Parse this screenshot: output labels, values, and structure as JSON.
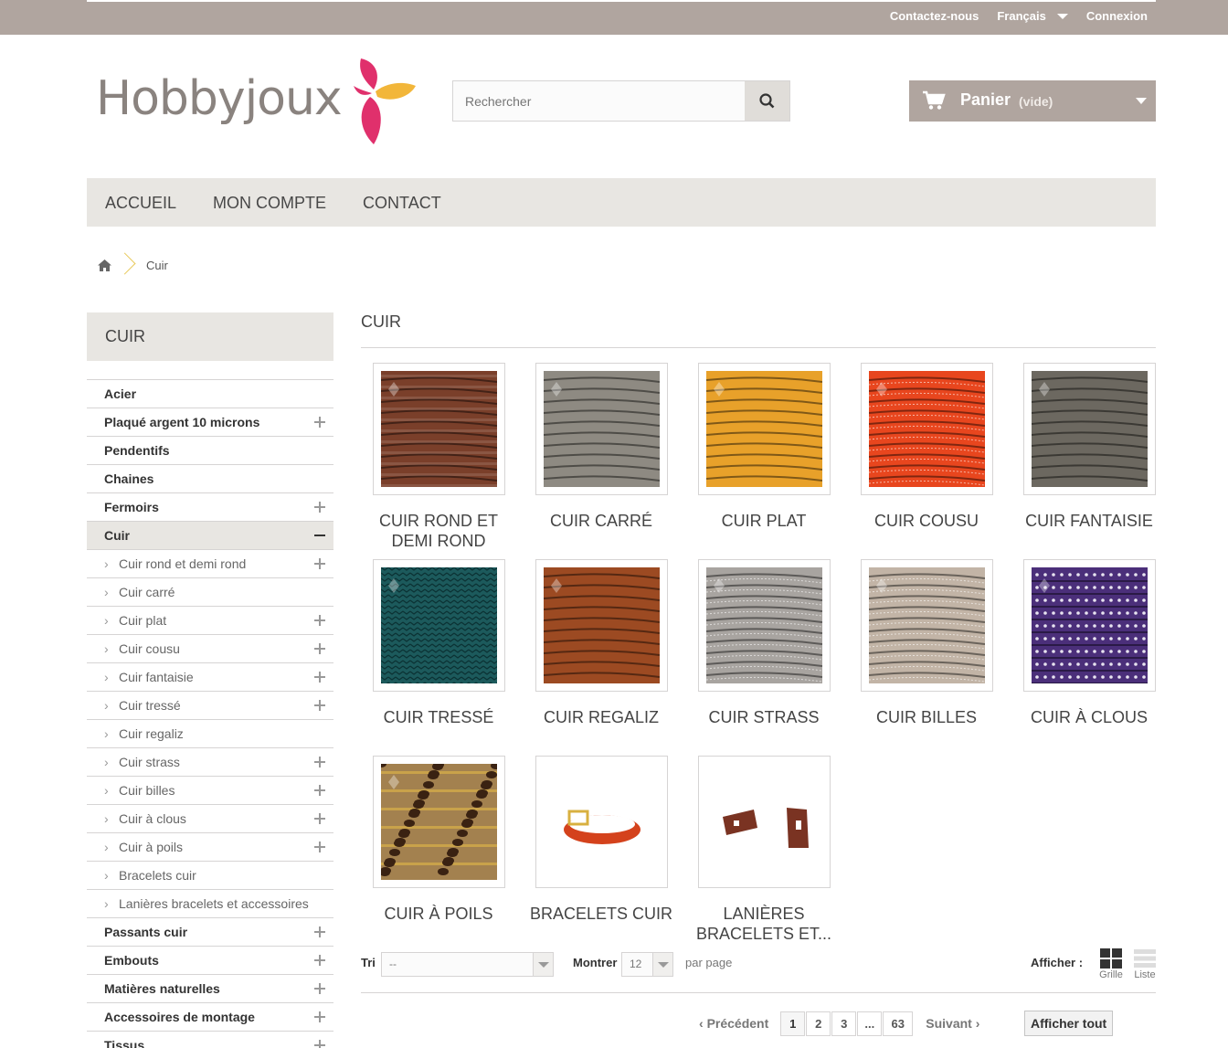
{
  "topbar": {
    "contact": "Contactez-nous",
    "language": "Français",
    "login": "Connexion"
  },
  "logo": {
    "text": "Hobbyjoux"
  },
  "search": {
    "placeholder": "Rechercher"
  },
  "cart": {
    "label": "Panier",
    "status": "(vide)"
  },
  "nav": {
    "items": [
      "ACCUEIL",
      "MON COMPTE",
      "CONTACT"
    ]
  },
  "breadcrumb": {
    "current": "Cuir"
  },
  "sidebar": {
    "title": "CUIR",
    "items": [
      {
        "label": "Acier",
        "toggle": ""
      },
      {
        "label": "Plaqué argent 10 microns",
        "toggle": "plus"
      },
      {
        "label": "Pendentifs",
        "toggle": ""
      },
      {
        "label": "Chaines",
        "toggle": ""
      },
      {
        "label": "Fermoirs",
        "toggle": "plus"
      },
      {
        "label": "Cuir",
        "toggle": "minus",
        "active": true
      },
      {
        "label": "Cuir rond et demi rond",
        "toggle": "plus",
        "sub": true
      },
      {
        "label": "Cuir carré",
        "toggle": "",
        "sub": true
      },
      {
        "label": "Cuir plat",
        "toggle": "plus",
        "sub": true
      },
      {
        "label": "Cuir cousu",
        "toggle": "plus",
        "sub": true
      },
      {
        "label": "Cuir fantaisie",
        "toggle": "plus",
        "sub": true
      },
      {
        "label": "Cuir tressé",
        "toggle": "plus",
        "sub": true
      },
      {
        "label": "Cuir regaliz",
        "toggle": "",
        "sub": true
      },
      {
        "label": "Cuir strass",
        "toggle": "plus",
        "sub": true
      },
      {
        "label": "Cuir billes",
        "toggle": "plus",
        "sub": true
      },
      {
        "label": "Cuir à clous",
        "toggle": "plus",
        "sub": true
      },
      {
        "label": "Cuir à poils",
        "toggle": "plus",
        "sub": true
      },
      {
        "label": "Bracelets cuir",
        "toggle": "",
        "sub": true
      },
      {
        "label": "Lanières bracelets et accessoires",
        "toggle": "",
        "sub": true
      },
      {
        "label": "Passants cuir",
        "toggle": "plus"
      },
      {
        "label": "Embouts",
        "toggle": "plus"
      },
      {
        "label": "Matières naturelles",
        "toggle": "plus"
      },
      {
        "label": "Accessoires de montage",
        "toggle": "plus"
      },
      {
        "label": "Tissus",
        "toggle": "plus"
      }
    ]
  },
  "content": {
    "title": "CUIR",
    "categories": [
      {
        "name": "CUIR ROND ET DEMI ROND",
        "color": "#7a3f2a",
        "style": "stripes"
      },
      {
        "name": "CUIR CARRÉ",
        "color": "#8e8a82",
        "style": "flat"
      },
      {
        "name": "CUIR PLAT",
        "color": "#e8a12a",
        "style": "flat"
      },
      {
        "name": "CUIR COUSU",
        "color": "#e8461e",
        "style": "stitched"
      },
      {
        "name": "CUIR FANTAISIE",
        "color": "#6c6860",
        "style": "flat"
      },
      {
        "name": "CUIR TRESSÉ",
        "color": "#1c5a5c",
        "style": "braid"
      },
      {
        "name": "CUIR REGALIZ",
        "color": "#9c4a22",
        "style": "flat"
      },
      {
        "name": "CUIR STRASS",
        "color": "#a8a4a0",
        "style": "stitched"
      },
      {
        "name": "CUIR BILLES",
        "color": "#c2b4a6",
        "style": "stitched"
      },
      {
        "name": "CUIR À CLOUS",
        "color": "#4b2f7a",
        "style": "dots"
      },
      {
        "name": "CUIR À POILS",
        "color": "#a3814f",
        "style": "leopard"
      },
      {
        "name": "BRACELETS CUIR",
        "color": "#d4421c",
        "style": "bracelet"
      },
      {
        "name": "LANIÈRES BRACELETS ET...",
        "color": "#7a3322",
        "style": "straps"
      }
    ]
  },
  "sortbar": {
    "sort_label": "Tri",
    "sort_value": "--",
    "show_label": "Montrer",
    "show_value": "12",
    "per_page": "par page",
    "display_label": "Afficher :",
    "grid_label": "Grille",
    "list_label": "Liste"
  },
  "pagination": {
    "prev": "Précédent",
    "pages": [
      "1",
      "2",
      "3",
      "...",
      "63"
    ],
    "next": "Suivant",
    "show_all": "Afficher tout"
  },
  "colors": {
    "topbar": "#b0a59f",
    "nav_bg": "#e8e6e2",
    "accent_pink": "#e0306c",
    "accent_yellow": "#f2b63a"
  }
}
